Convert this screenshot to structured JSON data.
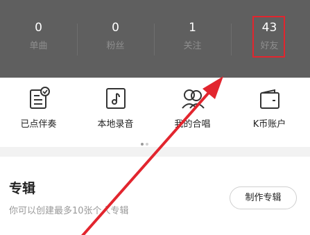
{
  "stats": [
    {
      "value": "0",
      "label": "单曲"
    },
    {
      "value": "0",
      "label": "粉丝"
    },
    {
      "value": "1",
      "label": "关注"
    },
    {
      "value": "43",
      "label": "好友"
    }
  ],
  "actions": [
    {
      "label": "已点伴奏",
      "icon": "song-list-icon"
    },
    {
      "label": "本地录音",
      "icon": "local-recording-icon"
    },
    {
      "label": "我的合唱",
      "icon": "chorus-icon"
    },
    {
      "label": "K币账户",
      "icon": "wallet-icon"
    }
  ],
  "carousel": {
    "pages": 2,
    "active_index": 0
  },
  "album": {
    "title": "专辑",
    "subtitle": "你可以创建最多10张个人专辑",
    "button": "制作专辑"
  },
  "annotation": {
    "color": "#e2252e",
    "highlight_target": "好友"
  }
}
